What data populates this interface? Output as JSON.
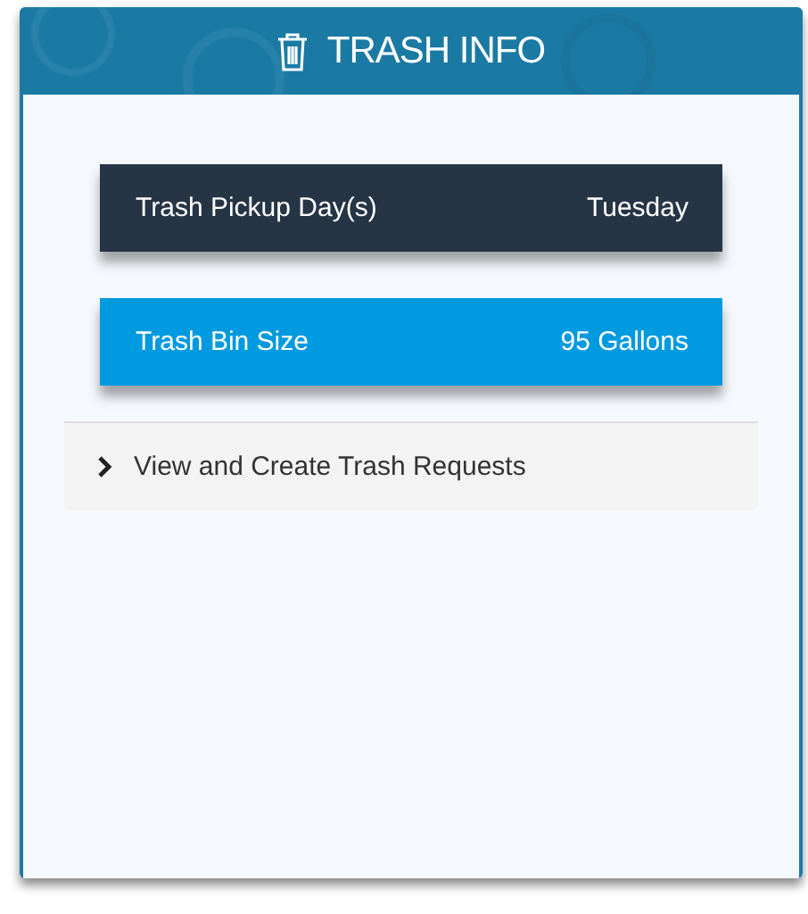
{
  "header": {
    "title": "TRASH INFO"
  },
  "info_rows": [
    {
      "label": "Trash Pickup Day(s)",
      "value": "Tuesday",
      "color": "#263545"
    },
    {
      "label": "Trash Bin Size",
      "value": "95 Gallons",
      "color": "#009ae0"
    }
  ],
  "accordion": {
    "label": "View and Create Trash Requests",
    "expanded": false
  }
}
